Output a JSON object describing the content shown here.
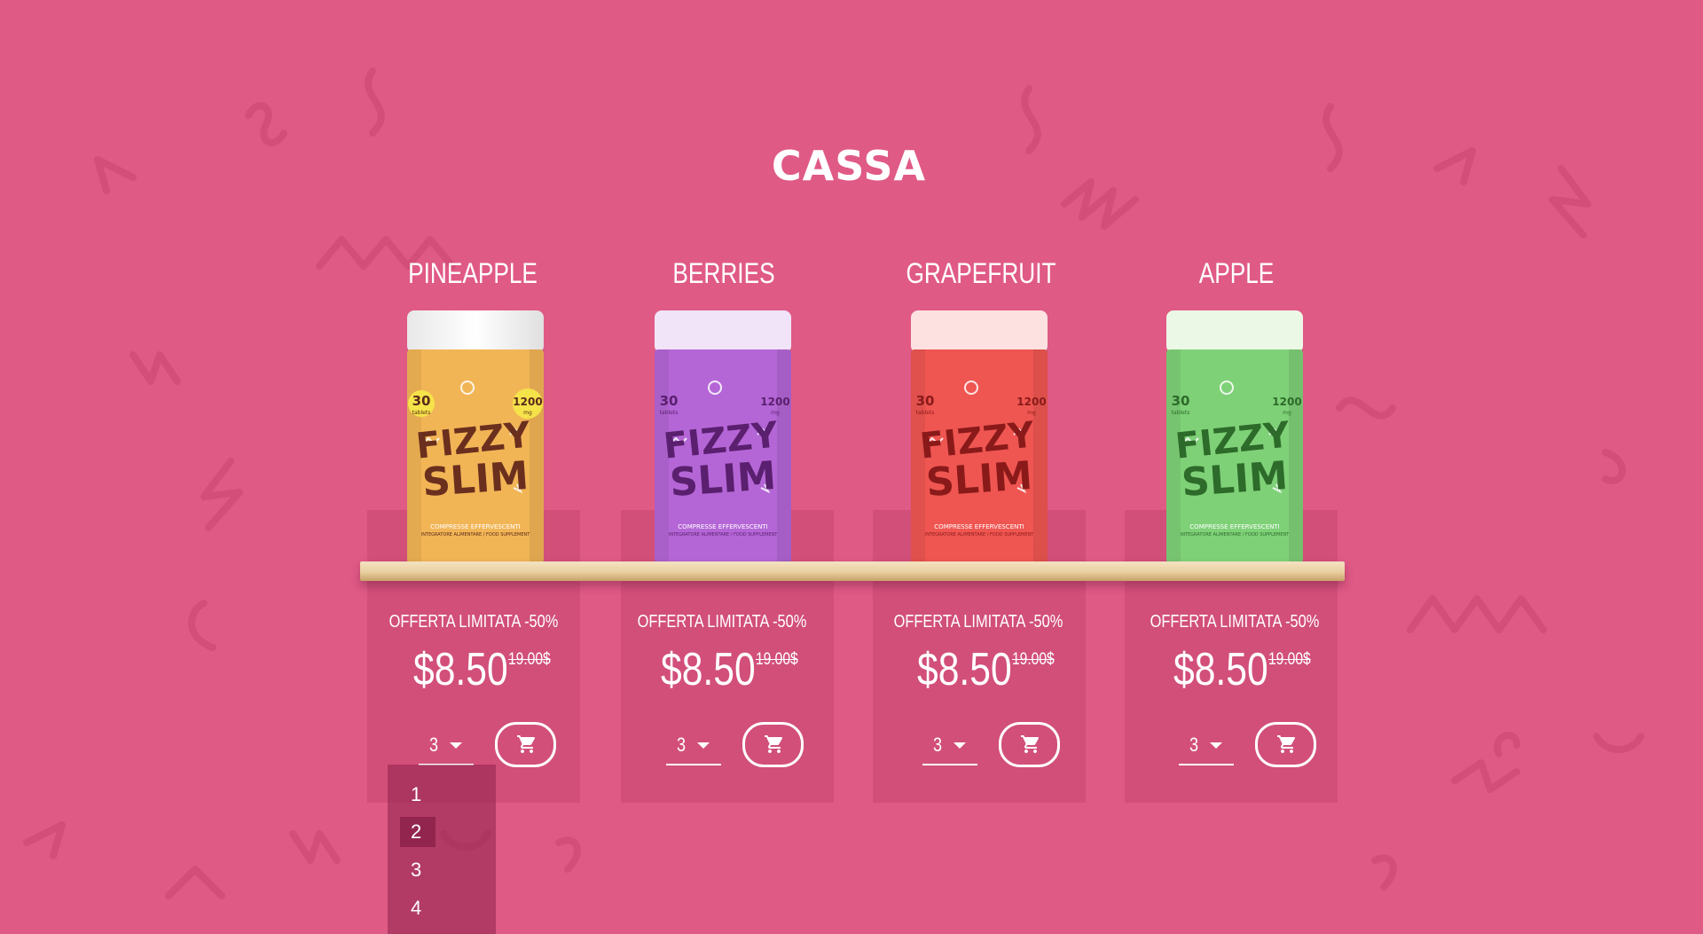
{
  "page": {
    "title": "CASSA",
    "background_color": "#e05a86"
  },
  "products": [
    {
      "name": "PINEAPPLE",
      "jar_color": "#f2b556",
      "jar_dark": "#d98a2c",
      "jar_text_color": "#6b2f1e",
      "jar_brand_top": "FIZZY",
      "jar_brand_bottom": "SLIM",
      "jar_tablets": "30",
      "jar_tablets_label": "tablets",
      "jar_mg": "1200",
      "jar_mg_label": "mg",
      "jar_tagline": "COMPRESSE EFFERVESCENTI",
      "jar_subline": "INTEGRATORE ALIMENTARE / FOOD SUPPLEMENT",
      "offer": "OFFERTA LIMITATA -50%",
      "price": "$8.50",
      "old_price": "19.00$",
      "quantity": "3",
      "cart_icon": "cart-icon"
    },
    {
      "name": "BERRIES",
      "jar_color": "#b466d6",
      "jar_dark": "#8d44b8",
      "jar_text_color": "#5a1f6e",
      "jar_brand_top": "FIZZY",
      "jar_brand_bottom": "SLIM",
      "jar_tablets": "30",
      "jar_tablets_label": "tablets",
      "jar_mg": "1200",
      "jar_mg_label": "mg",
      "jar_tagline": "COMPRESSE EFFERVESCENTI",
      "jar_subline": "INTEGRATORE ALIMENTARE / FOOD SUPPLEMENT",
      "offer": "OFFERTA LIMITATA -50%",
      "price": "$8.50",
      "old_price": "19.00$",
      "quantity": "3",
      "cart_icon": "cart-icon"
    },
    {
      "name": "GRAPEFRUIT",
      "jar_color": "#ef5651",
      "jar_dark": "#cf3333",
      "jar_text_color": "#8a1a1a",
      "jar_brand_top": "FIZZY",
      "jar_brand_bottom": "SLIM",
      "jar_tablets": "30",
      "jar_tablets_label": "tablets",
      "jar_mg": "1200",
      "jar_mg_label": "mg",
      "jar_tagline": "COMPRESSE EFFERVESCENTI",
      "jar_subline": "INTEGRATORE ALIMENTARE / FOOD SUPPLEMENT",
      "offer": "OFFERTA LIMITATA -50%",
      "price": "$8.50",
      "old_price": "19.00$",
      "quantity": "3",
      "cart_icon": "cart-icon"
    },
    {
      "name": "APPLE",
      "jar_color": "#7fd178",
      "jar_dark": "#5ab255",
      "jar_text_color": "#2d6b2a",
      "jar_brand_top": "FIZZY",
      "jar_brand_bottom": "SLIM",
      "jar_tablets": "30",
      "jar_tablets_label": "tablets",
      "jar_mg": "1200",
      "jar_mg_label": "mg",
      "jar_tagline": "COMPRESSE EFFERVESCENTI",
      "jar_subline": "INTEGRATORE ALIMENTARE / FOOD SUPPLEMENT",
      "offer": "OFFERTA LIMITATA -50%",
      "price": "$8.50",
      "old_price": "19.00$",
      "quantity": "3",
      "cart_icon": "cart-icon"
    }
  ],
  "quantity_dropdown": {
    "options": [
      "1",
      "2",
      "3",
      "4"
    ],
    "highlighted": "2"
  }
}
